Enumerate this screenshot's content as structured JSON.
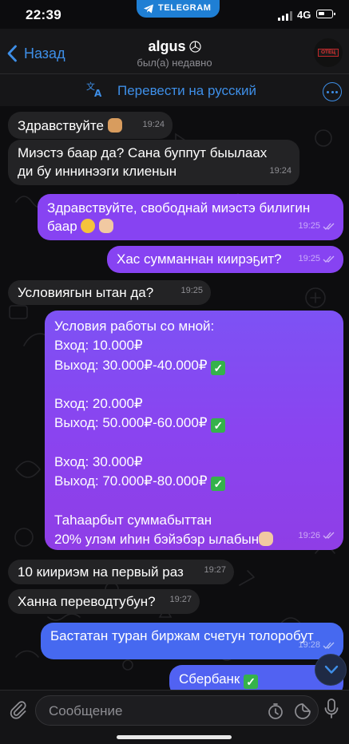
{
  "status_bar": {
    "time": "22:39",
    "telegram_label": "TELEGRAM",
    "network": "4G"
  },
  "header": {
    "back_label": "Назад",
    "title": "algus",
    "subtitle": "был(а) недавно",
    "avatar_text": "ОТЕЦ"
  },
  "translate": {
    "label": "Перевести на русский"
  },
  "messages": [
    {
      "dir": "in",
      "text": "Здравствуйте",
      "emoji_after": "fist",
      "time": "19:24"
    },
    {
      "dir": "in",
      "text": "Миэстэ баар да? Сана буппут быылаах\nди бу иннинээги клиенын",
      "time": "19:24"
    },
    {
      "dir": "out",
      "text": "Здравствуйте, свободнай миэстэ билигин\nбаар",
      "time": "19:25",
      "read": true
    },
    {
      "dir": "out",
      "text": "Хас сумманнан киирэҕит?",
      "time": "19:25",
      "read": true
    },
    {
      "dir": "in",
      "text": "Условиягын ытан да?",
      "time": "19:25"
    },
    {
      "dir": "out",
      "lines": [
        "Условия работы со мной:",
        "Вход: 10.000₽",
        "Выход: 30.000₽-40.000₽",
        "",
        "Вход: 20.000₽",
        "Выход: 50.000₽-60.000₽",
        "",
        "Вход: 30.000₽",
        "Выход: 70.000₽-80.000₽",
        "",
        "Таһаарбыт суммабыттан",
        "20% улэм иһин бэйэбэр ылабын"
      ],
      "time": "19:26",
      "read": true
    },
    {
      "dir": "in",
      "text": "10 киириэм на первый раз",
      "time": "19:27"
    },
    {
      "dir": "in",
      "text": "Ханна переводтубун?",
      "time": "19:27"
    },
    {
      "dir": "out",
      "text": "Бастатан туран биржам счетун толоробут",
      "time": "19:28",
      "read": true
    },
    {
      "dir": "out",
      "text": "Сбербанк"
    }
  ],
  "composer": {
    "placeholder": "Сообщение"
  },
  "colors": {
    "accent": "#3e8fe8",
    "outgoing": "#8743f2",
    "incoming": "#232325",
    "background": "#0d0d0f"
  }
}
